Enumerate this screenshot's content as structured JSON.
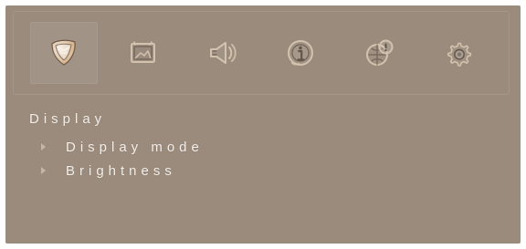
{
  "osd": {
    "tabs": [
      {
        "name": "display",
        "icon": "display-icon",
        "active": true
      },
      {
        "name": "picture",
        "icon": "picture-icon",
        "active": false
      },
      {
        "name": "audio",
        "icon": "speaker-icon",
        "active": false
      },
      {
        "name": "info",
        "icon": "info-icon",
        "active": false
      },
      {
        "name": "multiwindow",
        "icon": "multi-window-icon",
        "active": false
      },
      {
        "name": "settings",
        "icon": "gear-icon",
        "active": false
      }
    ],
    "menu_title": "Display",
    "items": [
      {
        "label": "Display mode"
      },
      {
        "label": "Brightness"
      }
    ]
  },
  "colors": {
    "panel": "#9a8b7c",
    "text": "#f3eee8",
    "icon": "#d7c7b3",
    "icon_dark": "#5e5146",
    "active_glow": "#f1d3a8"
  }
}
